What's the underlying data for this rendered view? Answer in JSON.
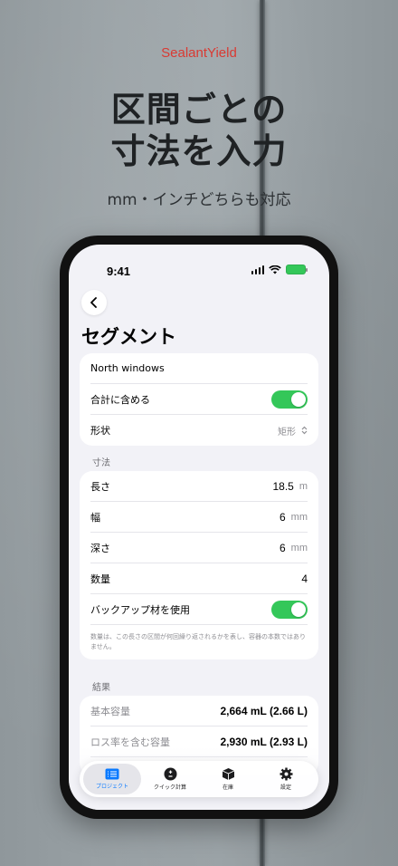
{
  "promo": {
    "brand": "SealantYield",
    "headline_line1": "区間ごとの",
    "headline_line2": "寸法を入力",
    "subline": "mm・インチどちらも対応"
  },
  "status_bar": {
    "time": "9:41"
  },
  "page": {
    "title": "セグメント"
  },
  "segment": {
    "name": "North windows",
    "include_in_total_label": "合計に含める",
    "include_in_total": true,
    "shape_label": "形状",
    "shape_value": "矩形"
  },
  "dimensions": {
    "section_label": "寸法",
    "length_label": "長さ",
    "length_value": "18.5",
    "length_unit": "m",
    "width_label": "幅",
    "width_value": "6",
    "width_unit": "mm",
    "depth_label": "深さ",
    "depth_value": "6",
    "depth_unit": "mm",
    "quantity_label": "数量",
    "quantity_value": "4",
    "backer_rod_label": "バックアップ材を使用",
    "backer_rod": true,
    "note": "数量は、この長さの区間が何回繰り返されるかを表し、容器の本数ではありません。"
  },
  "results": {
    "section_label": "結果",
    "base_volume_label": "基本容量",
    "base_volume_value": "2,664 mL (2.66 L)",
    "with_loss_label": "ロス率を含む容量",
    "with_loss_value": "2,930 mL (2.93 L)"
  },
  "tabbar": {
    "tabs": [
      {
        "label": "プロジェクト",
        "icon": "list-icon",
        "active": true
      },
      {
        "label": "クイック計算",
        "icon": "plus-minus-icon",
        "active": false
      },
      {
        "label": "在庫",
        "icon": "box-icon",
        "active": false
      },
      {
        "label": "設定",
        "icon": "gear-icon",
        "active": false
      }
    ]
  },
  "colors": {
    "brand": "#d93a33",
    "toggle_on": "#34c759",
    "accent": "#0a7aff"
  }
}
